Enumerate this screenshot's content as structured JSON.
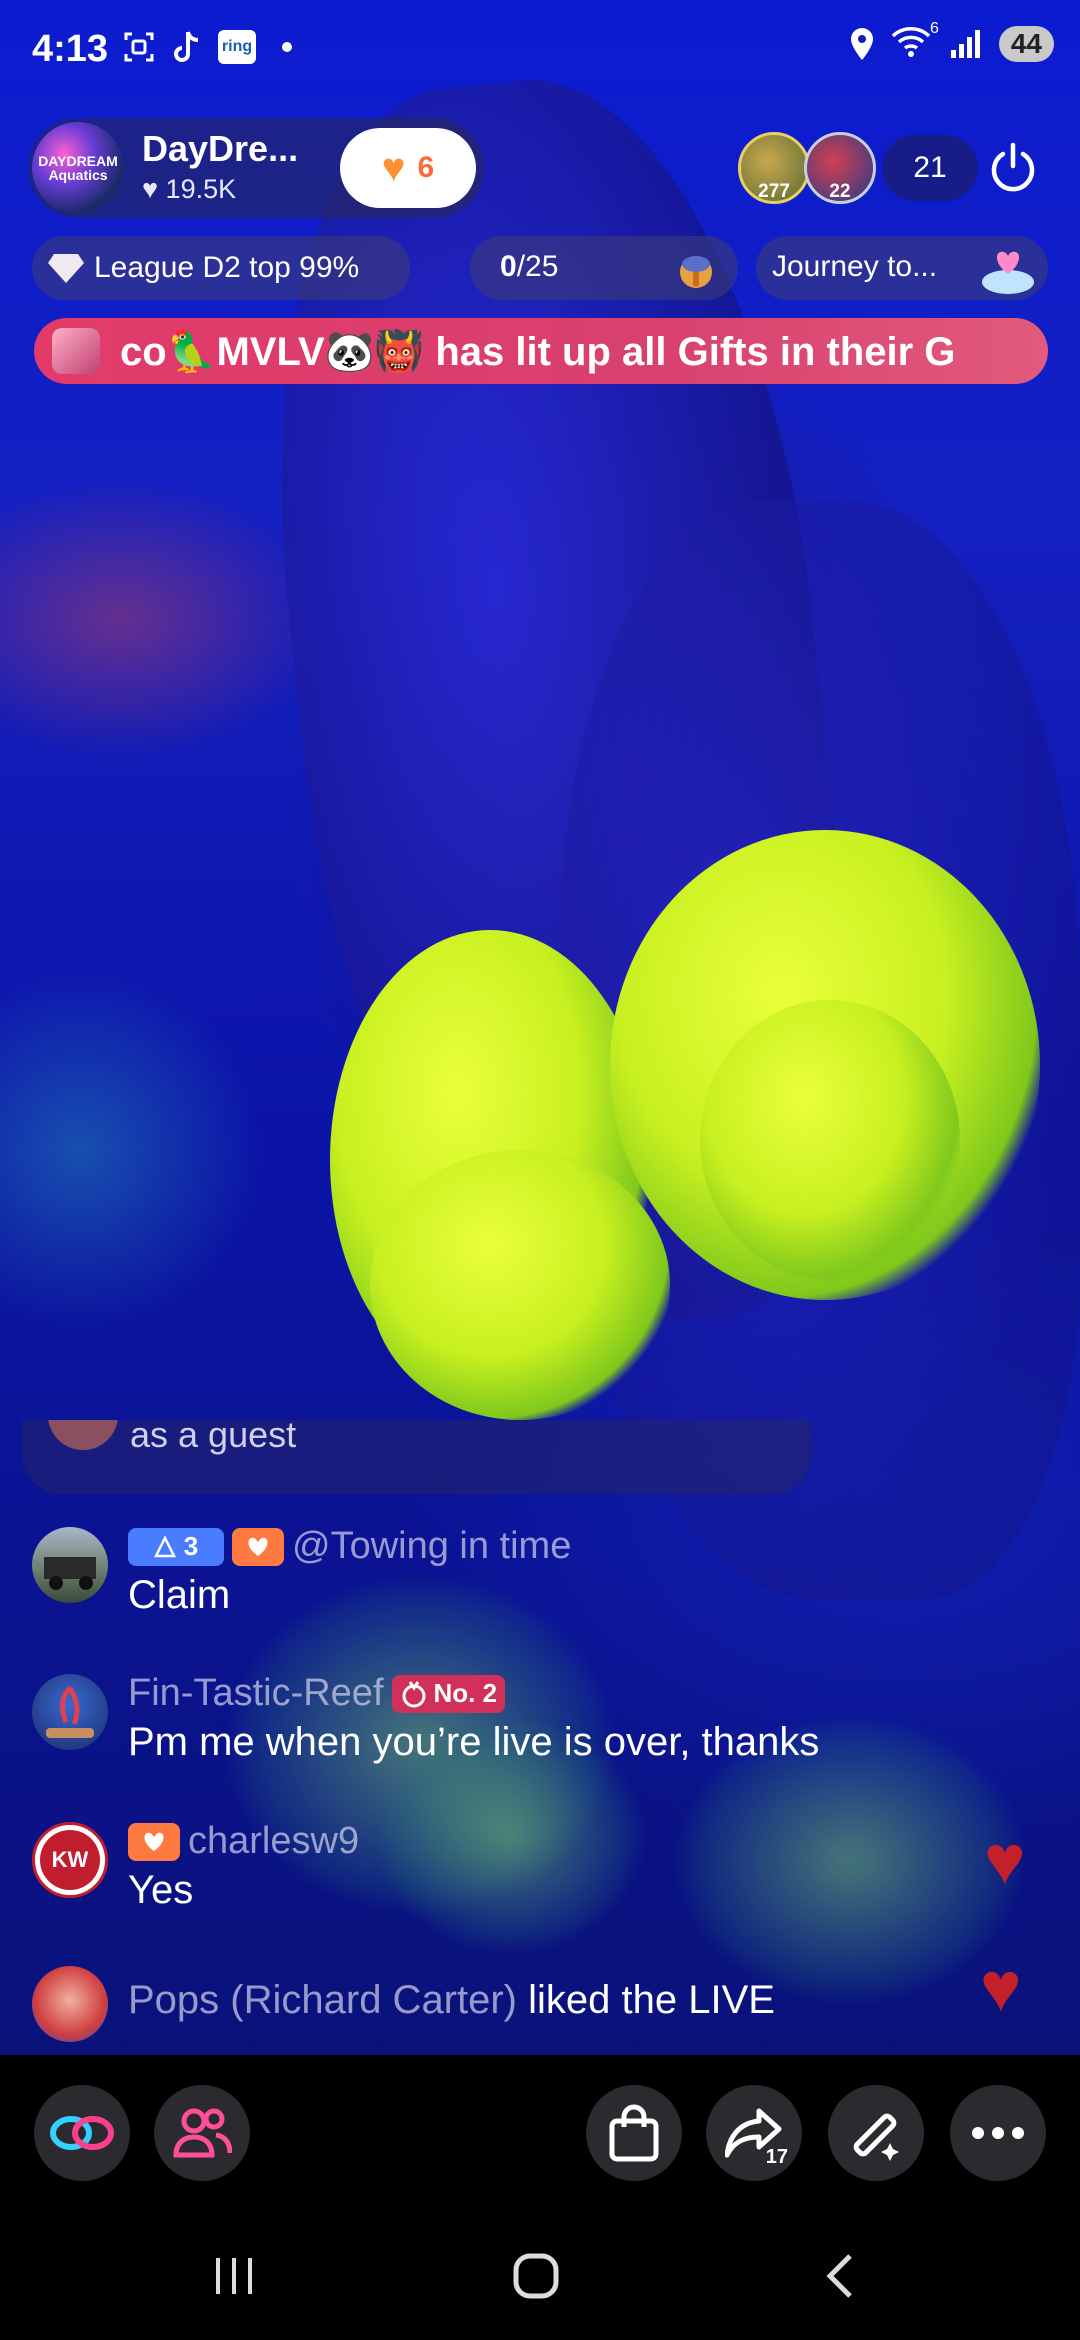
{
  "status_bar": {
    "time": "4:13",
    "notification_icons": [
      "screenshot-icon",
      "tiktok-icon",
      "ring-icon",
      "dot-icon"
    ],
    "ring_label": "ring",
    "wifi_label": "6",
    "battery": "44"
  },
  "host": {
    "name": "DayDre...",
    "avatar_text": "DAYDREAM Aquatics",
    "likes": "19.5K",
    "follow_count": "6"
  },
  "viewers": {
    "top_viewers": [
      {
        "badge": "277"
      },
      {
        "badge": "22"
      }
    ],
    "count": "21"
  },
  "league": {
    "label": "League D2 top 99%"
  },
  "progress": {
    "current": "0",
    "total": "/25"
  },
  "journey": {
    "label": "Journey to..."
  },
  "banner": {
    "text": "co🦜MVLV🐼👹 has lit up all Gifts in their G"
  },
  "chat": {
    "guest_fragment": "as a guest",
    "messages": [
      {
        "level": "3",
        "user": "@Towing in time",
        "text": "Claim"
      },
      {
        "user": "Fin-Tastic-Reef",
        "rank": "No. 2",
        "text": "Pm me when you’re live is over, thanks"
      },
      {
        "avatar_text": "KW",
        "user": "charlesw9",
        "text": "Yes"
      }
    ],
    "liked": {
      "user": "Pops (Richard Carter)",
      "text": " liked the LIVE"
    }
  },
  "toolbar": {
    "share_count": "17"
  }
}
